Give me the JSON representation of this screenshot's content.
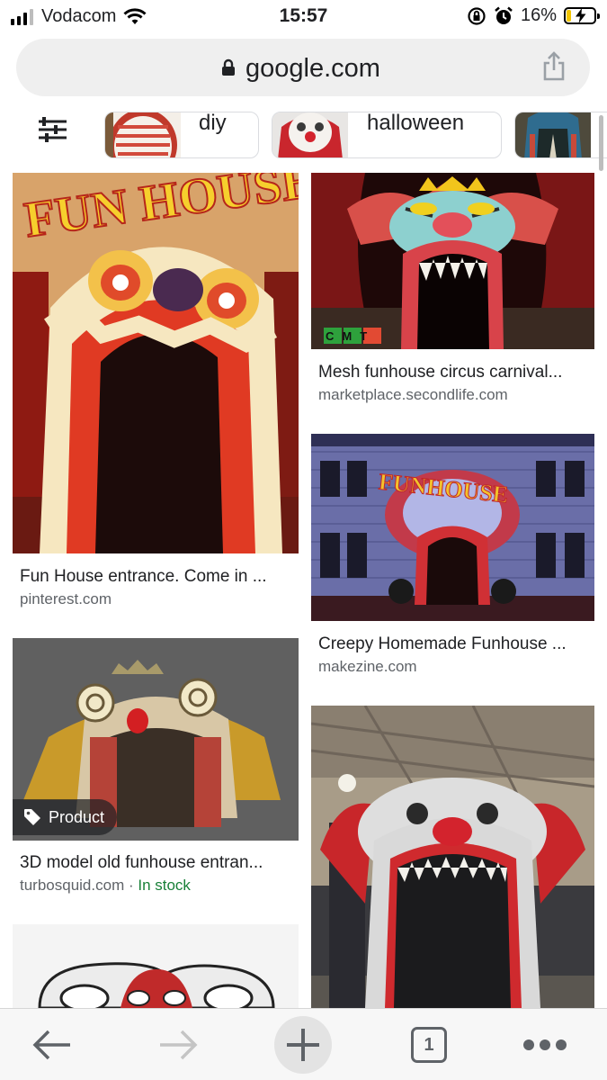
{
  "status_bar": {
    "carrier": "Vodacom",
    "time": "15:57",
    "battery": "16%"
  },
  "url_bar": {
    "host": "google.com"
  },
  "chips": [
    {
      "label": "diy"
    },
    {
      "label": "halloween"
    }
  ],
  "results": [
    {
      "title": "Fun House entrance. Come in ...",
      "source": "pinterest.com"
    },
    {
      "title": "Mesh funhouse circus carnival...",
      "source": "marketplace.secondlife.com"
    },
    {
      "title": "Creepy Homemade Funhouse ...",
      "source": "makezine.com"
    },
    {
      "title": "3D model old funhouse entran...",
      "source": "turbosquid.com",
      "separator": " · ",
      "availability": "In stock",
      "badge": "Product"
    }
  ],
  "image_text": {
    "fun_house_sign": "FUN HOUSE",
    "funhouse_sign": "FUNHOUSE",
    "cmt_logo": "CMT"
  },
  "toolbar": {
    "tab_count": "1"
  },
  "colors": {
    "accent_green": "#188038",
    "source_gray": "#5f6368",
    "url_bar_bg": "#efefef"
  }
}
